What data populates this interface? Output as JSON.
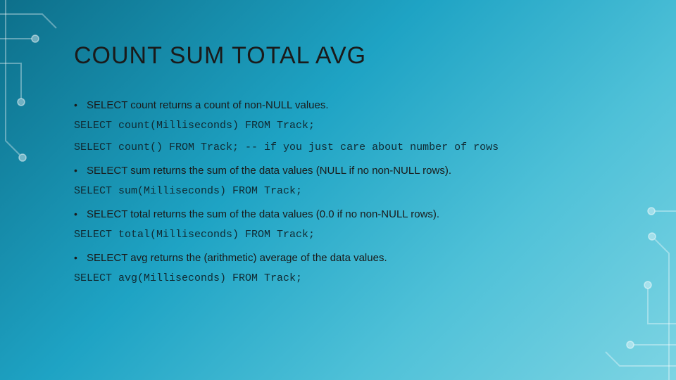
{
  "slide": {
    "title": "COUNT SUM TOTAL AVG",
    "items": [
      {
        "type": "bullet",
        "text": "SELECT count returns a count of non-NULL values."
      },
      {
        "type": "code",
        "text": "SELECT count(Milliseconds) FROM Track;"
      },
      {
        "type": "code",
        "text": "SELECT count() FROM Track; -- if you just care about number of rows"
      },
      {
        "type": "bullet",
        "text": "SELECT sum returns the sum of the data values (NULL if no non-NULL rows)."
      },
      {
        "type": "code",
        "text": "SELECT sum(Milliseconds) FROM Track;"
      },
      {
        "type": "bullet",
        "text": "SELECT total returns the sum of the data values (0.0 if no non-NULL rows)."
      },
      {
        "type": "code",
        "text": "SELECT total(Milliseconds) FROM Track;"
      },
      {
        "type": "bullet",
        "text": "SELECT avg returns the (arithmetic) average of the data values."
      },
      {
        "type": "code",
        "text": "SELECT avg(Milliseconds) FROM Track;"
      }
    ]
  }
}
